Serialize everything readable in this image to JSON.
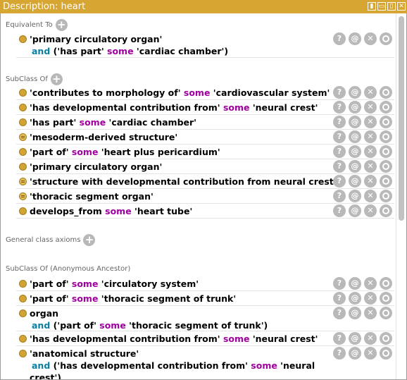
{
  "window": {
    "title": "Description: heart",
    "buttons": [
      "▮",
      "▭",
      "▯",
      "✕"
    ]
  },
  "actions": {
    "help": "?",
    "annotate": "@",
    "delete": "✕",
    "edit": ""
  },
  "sections": {
    "equivalent_to": {
      "label": "Equivalent To",
      "add": "+",
      "item": {
        "line1": "'primary circulatory organ'",
        "line2_and": "and",
        "line2_a": " ('has part' ",
        "line2_some": "some",
        "line2_b": " 'cardiac chamber')"
      }
    },
    "subclass_of": {
      "label": "SubClass Of",
      "add": "+",
      "items": [
        {
          "a": "'contributes to morphology of' ",
          "some": "some",
          "b": " 'cardiovascular system'"
        },
        {
          "a": "'has developmental contribution from' ",
          "some": "some",
          "b": " 'neural crest'"
        },
        {
          "a": "'has part' ",
          "some": "some",
          "b": " 'cardiac chamber'"
        },
        {
          "a": "'mesoderm-derived structure'",
          "some": "",
          "b": ""
        },
        {
          "a": "'part of' ",
          "some": "some",
          "b": " 'heart plus pericardium'"
        },
        {
          "a": "'primary circulatory organ'",
          "some": "",
          "b": ""
        },
        {
          "a": "'structure with developmental contribution from neural crest'",
          "some": "",
          "b": ""
        },
        {
          "a": "'thoracic segment organ'",
          "some": "",
          "b": ""
        },
        {
          "a": "develops_from ",
          "some": "some",
          "b": " 'heart tube'"
        }
      ]
    },
    "general_axioms": {
      "label": "General class axioms",
      "add": "+"
    },
    "anonymous_ancestor": {
      "label": "SubClass Of (Anonymous Ancestor)",
      "items": [
        {
          "a": "'part of' ",
          "some": "some",
          "b": " 'circulatory system'"
        },
        {
          "a": "'part of' ",
          "some": "some",
          "b": " 'thoracic segment of trunk'"
        },
        {
          "a": "organ",
          "line2_and": "and",
          "line2_a": " ('part of' ",
          "line2_some": "some",
          "line2_b": " 'thoracic segment of trunk')"
        },
        {
          "a": "'has developmental contribution from' ",
          "some": "some",
          "b": " 'neural crest'"
        },
        {
          "a": "'anatomical structure'",
          "line2_and": "and",
          "line2_a": " ('has developmental contribution from' ",
          "line2_some": "some",
          "line2_b": " 'neural",
          "line3": "crest')"
        }
      ]
    }
  }
}
